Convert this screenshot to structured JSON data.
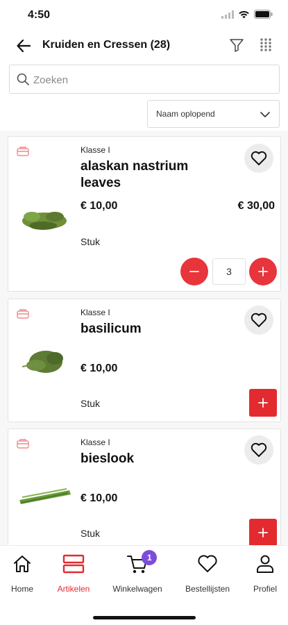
{
  "status": {
    "time": "4:50"
  },
  "header": {
    "title": "Kruiden en Cressen (28)"
  },
  "search": {
    "placeholder": "Zoeken"
  },
  "sort": {
    "selected": "Naam oplopend"
  },
  "products": [
    {
      "class": "Klasse I",
      "name": "alaskan nastrium leaves",
      "price": "€ 10,00",
      "price_total": "€ 30,00",
      "unit": "Stuk",
      "quantity": "3",
      "image_color": "#6f8f3a"
    },
    {
      "class": "Klasse I",
      "name": "basilicum",
      "price": "€ 10,00",
      "unit": "Stuk",
      "image_color": "#5d7b34"
    },
    {
      "class": "Klasse I",
      "name": "bieslook",
      "price": "€ 10,00",
      "unit": "Stuk",
      "image_color": "#6a9a3a"
    }
  ],
  "tabs": [
    {
      "label": "Home",
      "icon": "home-icon"
    },
    {
      "label": "Artikelen",
      "icon": "articles-icon",
      "active": true
    },
    {
      "label": "Winkelwagen",
      "icon": "cart-icon",
      "badge": "1"
    },
    {
      "label": "Bestellijsten",
      "icon": "heart-icon"
    },
    {
      "label": "Profiel",
      "icon": "profile-icon"
    }
  ],
  "colors": {
    "accent": "#e32b2f",
    "badge": "#7c4ddb"
  }
}
